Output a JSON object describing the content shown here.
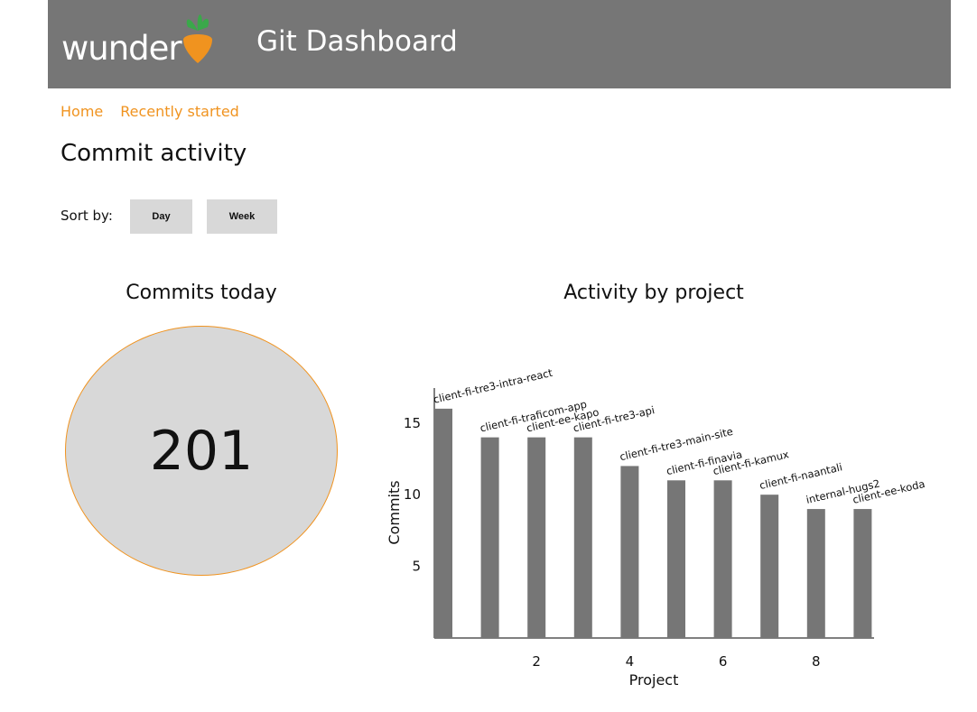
{
  "header": {
    "logo_text": "wunder",
    "app_title": "Git Dashboard",
    "brand_color": "#767676",
    "accent_color": "#f0931f"
  },
  "breadcrumb": {
    "home": "Home",
    "recent": "Recently started"
  },
  "page_title": "Commit activity",
  "sort": {
    "label": "Sort by:",
    "day": "Day",
    "week": "Week"
  },
  "commits_today": {
    "title": "Commits today",
    "value": "201"
  },
  "activity": {
    "title": "Activity by project"
  },
  "chart_data": {
    "type": "bar",
    "categories": [
      "client-fi-tre3-intra-react",
      "client-fi-traficom-app",
      "client-ee-kapo",
      "client-fi-tre3-api",
      "client-fi-tre3-main-site",
      "client-fi-finavia",
      "client-fi-kamux",
      "client-fi-naantali",
      "internal-hugs2",
      "client-ee-koda"
    ],
    "x": [
      0,
      1,
      2,
      3,
      4,
      5,
      6,
      7,
      8,
      9
    ],
    "values": [
      16,
      14,
      14,
      14,
      12,
      11,
      11,
      10,
      9,
      9
    ],
    "xlabel": "Project",
    "ylabel": "Commits",
    "xticks": [
      2,
      4,
      6,
      8
    ],
    "yticks": [
      5,
      10,
      15
    ],
    "ylim": [
      0,
      17
    ],
    "grid": false,
    "bar_color": "#767676"
  }
}
